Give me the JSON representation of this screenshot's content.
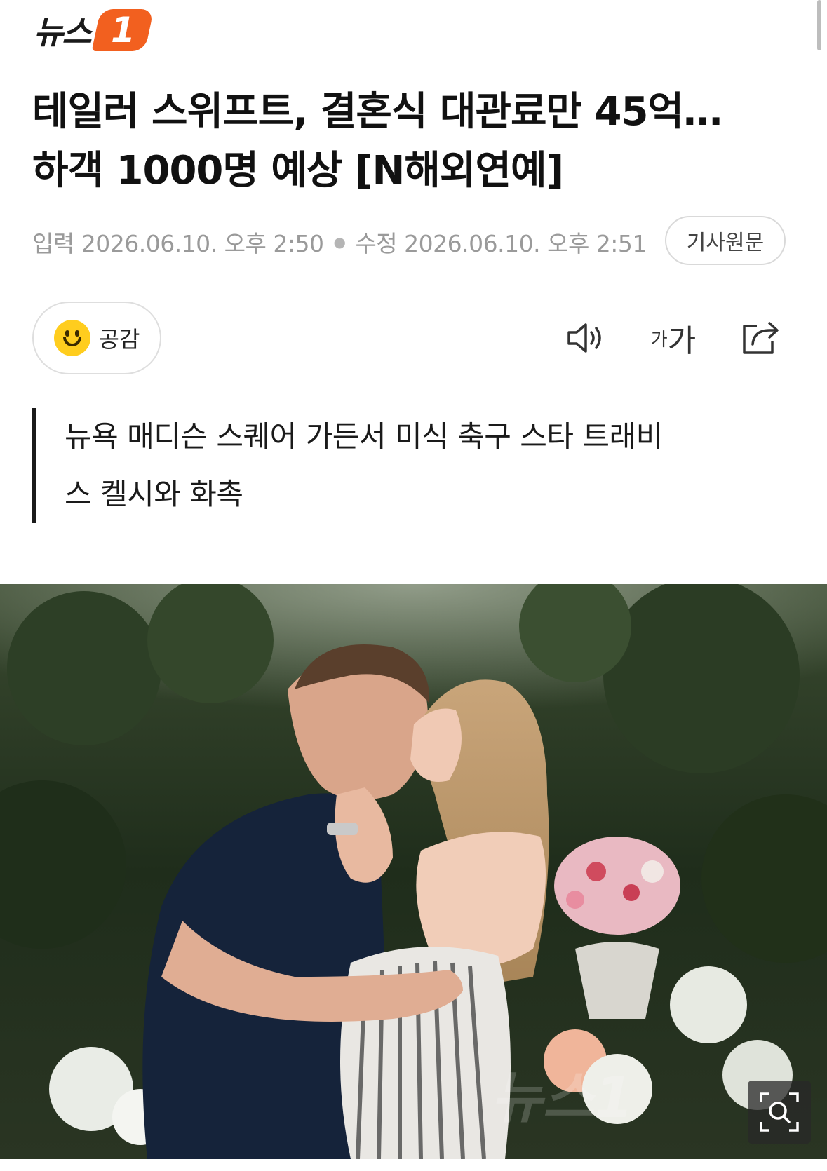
{
  "brand": {
    "logo_text": "뉴스",
    "logo_badge": "1",
    "accent_color": "#f2601f"
  },
  "article": {
    "headline_line1": "테일러 스위프트, 결혼식 대관료만 45억…",
    "headline_line2": "하객 1000명 예상 [N해외연예]",
    "published_label": "입력",
    "published": "2026.06.10. 오후 2:50",
    "updated_label": "수정",
    "updated": "2026.06.10. 오후 2:51",
    "source_button": "기사원문",
    "summary_line1": "뉴욕 매디슨 스퀘어 가든서 미식 축구 스타 트래비",
    "summary_line2": "스 켈시와 화촉"
  },
  "toolbar": {
    "empathy_label": "공감",
    "font_small": "가",
    "font_big": "가",
    "speaker_icon": "speaker-icon",
    "share_icon": "share-icon",
    "zoom_icon": "zoom-icon"
  }
}
